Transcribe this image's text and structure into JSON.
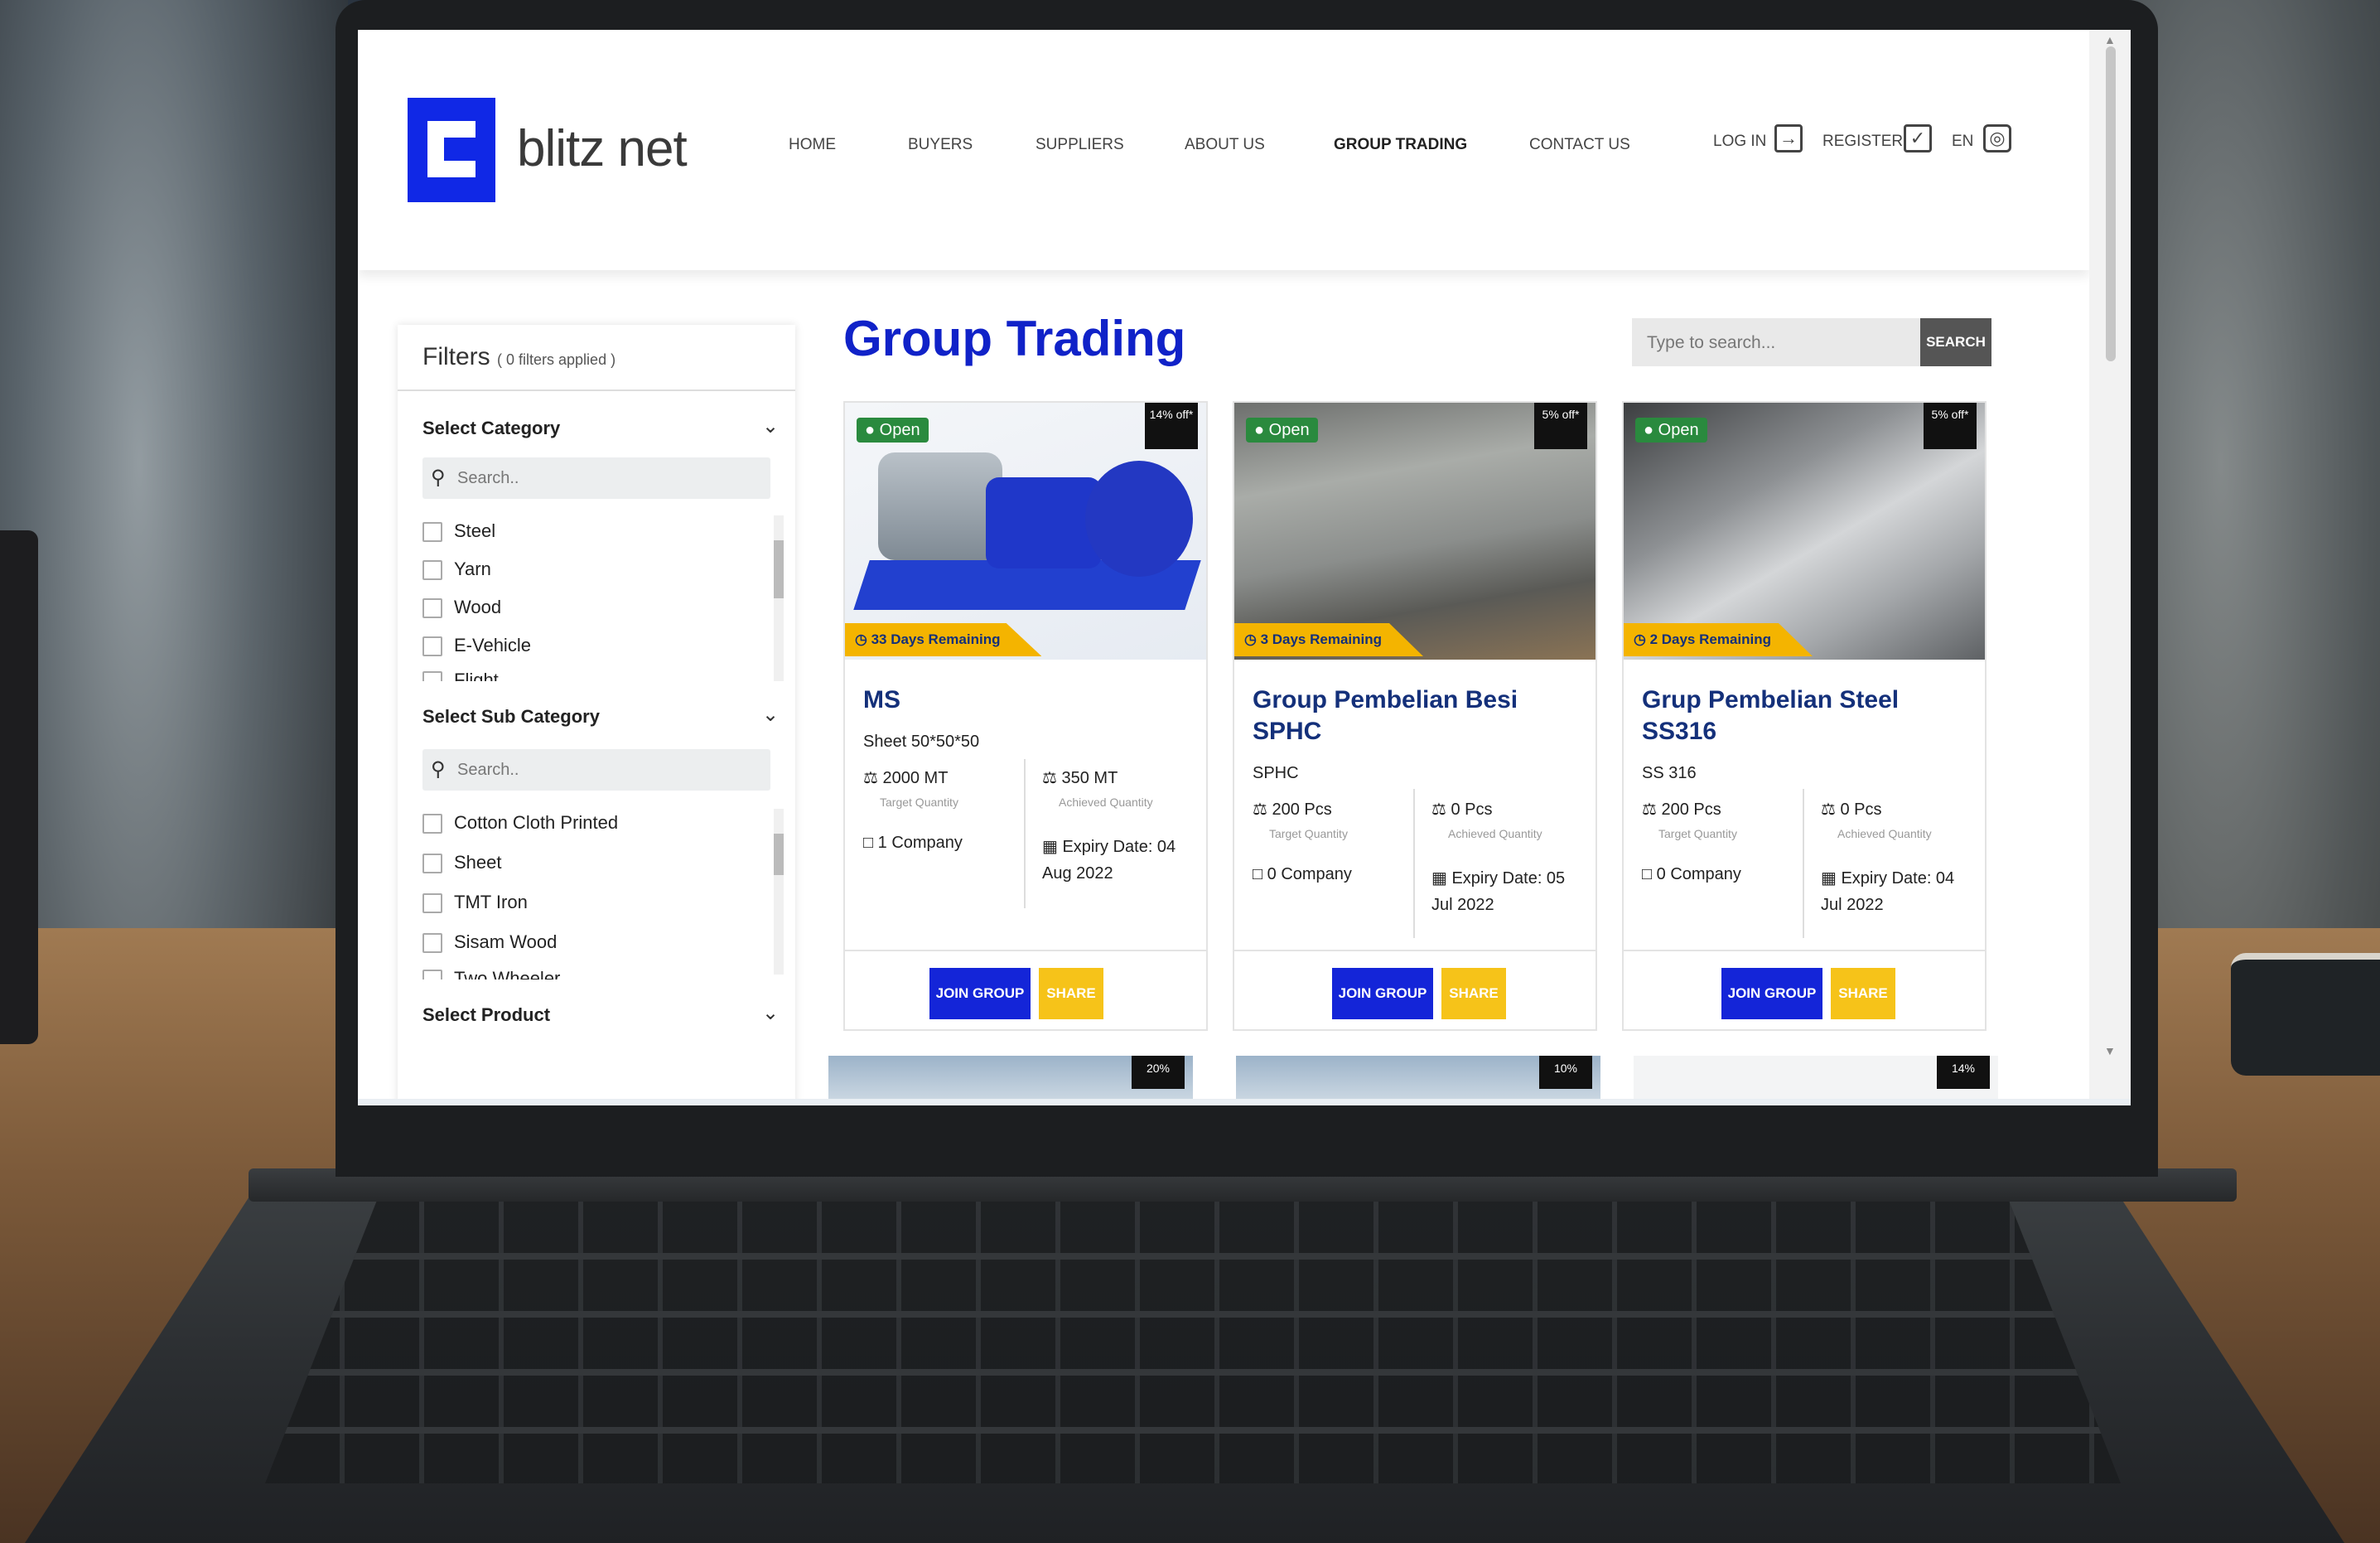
{
  "brand": {
    "name": "blitz net"
  },
  "nav": {
    "items": [
      "HOME",
      "BUYERS",
      "SUPPLIERS",
      "ABOUT US",
      "GROUP TRADING",
      "CONTACT US"
    ],
    "active": "GROUP TRADING",
    "login": "LOG IN",
    "register": "REGISTER",
    "language": "EN"
  },
  "filters": {
    "title": "Filters",
    "applied": "( 0 filters applied )",
    "category": {
      "title": "Select Category",
      "placeholder": "Search..",
      "options": [
        "Steel",
        "Yarn",
        "Wood",
        "E-Vehicle",
        "Flight"
      ]
    },
    "sub_category": {
      "title": "Select Sub Category",
      "placeholder": "Search..",
      "options": [
        "Cotton Cloth Printed",
        "Sheet",
        "TMT Iron",
        "Sisam Wood",
        "Two Wheeler"
      ]
    },
    "product": {
      "title": "Select Product"
    }
  },
  "main": {
    "title": "Group Trading",
    "search_placeholder": "Type to search...",
    "search_button": "SEARCH"
  },
  "cards": [
    {
      "status": "Open",
      "discount": "14% off*",
      "days": "33 Days Remaining",
      "title": "MS",
      "subtitle": "Sheet 50*50*50",
      "target_qty": "2000 MT",
      "target_label": "Target Quantity",
      "achieved_qty": "350 MT",
      "achieved_label": "Achieved Quantity",
      "companies": "1 Company",
      "expiry": "Expiry Date: 04 Aug 2022",
      "join": "JOIN GROUP",
      "share": "SHARE"
    },
    {
      "status": "Open",
      "discount": "5% off*",
      "days": "3 Days Remaining",
      "title": "Group Pembelian Besi SPHC",
      "subtitle": "SPHC",
      "target_qty": "200 Pcs",
      "target_label": "Target Quantity",
      "achieved_qty": "0 Pcs",
      "achieved_label": "Achieved Quantity",
      "companies": "0 Company",
      "expiry": "Expiry Date: 05 Jul 2022",
      "join": "JOIN GROUP",
      "share": "SHARE"
    },
    {
      "status": "Open",
      "discount": "5% off*",
      "days": "2 Days Remaining",
      "title": "Grup Pembelian Steel SS316",
      "subtitle": "SS 316",
      "target_qty": "200 Pcs",
      "target_label": "Target Quantity",
      "achieved_qty": "0 Pcs",
      "achieved_label": "Achieved Quantity",
      "companies": "0 Company",
      "expiry": "Expiry Date: 04 Jul 2022",
      "join": "JOIN GROUP",
      "share": "SHARE"
    }
  ],
  "peek_badges": [
    "20%",
    "10%",
    "14%"
  ],
  "colors": {
    "brand_blue": "#1425d8",
    "share_yellow": "#f6c319",
    "days_yellow": "#f4b400",
    "open_green": "#2a8a3e"
  }
}
